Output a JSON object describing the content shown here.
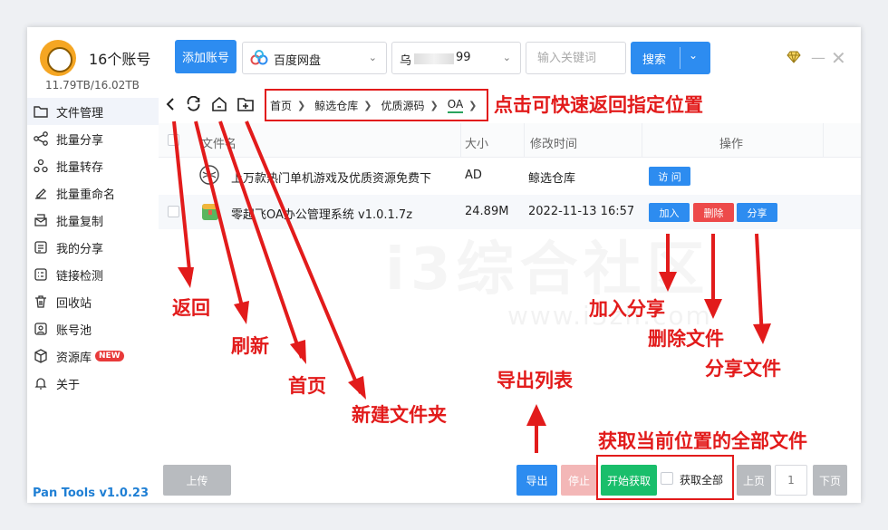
{
  "sidebar": {
    "account_count": "16个账号",
    "storage": "11.79TB/16.02TB",
    "items": [
      {
        "label": "文件管理",
        "icon": "folder-icon"
      },
      {
        "label": "批量分享",
        "icon": "share-icon"
      },
      {
        "label": "批量转存",
        "icon": "transfer-icon"
      },
      {
        "label": "批量重命名",
        "icon": "rename-icon"
      },
      {
        "label": "批量复制",
        "icon": "copy-icon"
      },
      {
        "label": "我的分享",
        "icon": "my-share-icon"
      },
      {
        "label": "链接检测",
        "icon": "link-check-icon"
      },
      {
        "label": "回收站",
        "icon": "trash-icon"
      },
      {
        "label": "账号池",
        "icon": "account-pool-icon"
      },
      {
        "label": "资源库",
        "icon": "library-icon",
        "badge": "NEW"
      },
      {
        "label": "关于",
        "icon": "bell-icon"
      }
    ],
    "version": "Pan Tools v1.0.23"
  },
  "topbar": {
    "add_account": "添加账号",
    "cloud_select": "百度网盘",
    "account_select_prefix": "乌",
    "account_select_suffix": "99",
    "search_placeholder": "输入关键词",
    "search_button": "搜索"
  },
  "breadcrumb": {
    "items": [
      "首页",
      "鲸选仓库",
      "优质源码",
      "OA"
    ]
  },
  "table": {
    "headers": [
      "文件名",
      "大小",
      "修改时间",
      "操作"
    ],
    "rows": [
      {
        "name": "上万款热门单机游戏及优质资源免费下",
        "size": "AD",
        "modified": "鲸选仓库",
        "actions": [
          "访 问"
        ]
      },
      {
        "name": "零起飞OA办公管理系统 v1.0.1.7z",
        "size": "24.89M",
        "modified": "2022-11-13 16:57",
        "actions": [
          "加入",
          "删除",
          "分享"
        ]
      }
    ]
  },
  "bottom": {
    "upload": "上传",
    "export": "导出",
    "stop": "停止",
    "start_fetch": "开始获取",
    "fetch_all": "获取全部",
    "prev_page": "上页",
    "page_number": "1",
    "next_page": "下页"
  },
  "watermark": {
    "text": "i3综合社区",
    "url": "www.i3zh.com"
  },
  "annotations": {
    "breadcrumb_hint": "点击可快速返回指定位置",
    "back": "返回",
    "refresh": "刷新",
    "home": "首页",
    "new_folder": "新建文件夹",
    "export_list": "导出列表",
    "join_share": "加入分享",
    "delete_file": "删除文件",
    "share_file": "分享文件",
    "fetch_all_files": "获取当前位置的全部文件"
  },
  "colors": {
    "primary": "#2d8cf0",
    "danger": "#ed4a4a",
    "success": "#19be6b",
    "annotation": "#e21b1b",
    "disabled": "#b8bbbf"
  }
}
